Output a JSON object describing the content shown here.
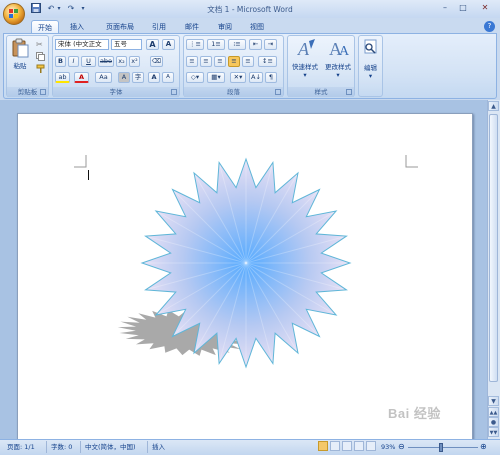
{
  "window": {
    "title": "文档 1 - Microsoft Word",
    "controls": {
      "minimize": "–",
      "maximize": "□",
      "close": "✕"
    }
  },
  "qat": {
    "save_icon": "save-icon",
    "undo": "↶",
    "redo": "↷",
    "dropdown": "▾"
  },
  "tabs": [
    {
      "label": "开始",
      "active": true
    },
    {
      "label": "插入"
    },
    {
      "label": "页面布局"
    },
    {
      "label": "引用"
    },
    {
      "label": "邮件"
    },
    {
      "label": "审阅"
    },
    {
      "label": "视图"
    }
  ],
  "ribbon": {
    "clipboard": {
      "paste_label": "粘贴",
      "group_label": "剪贴板"
    },
    "font": {
      "font_name": "宋体 (中文正文",
      "font_size": "五号",
      "grow": "A",
      "shrink": "A",
      "bold": "B",
      "italic": "I",
      "underline": "U",
      "strike": "abe",
      "subscript": "x₂",
      "superscript": "x²",
      "case": "Aa",
      "highlight": "ab",
      "font_color": "A",
      "char_border": "A",
      "enclosed": "字",
      "wen": "wén",
      "group_label": "字体"
    },
    "paragraph": {
      "group_label": "段落",
      "sort": "A↓",
      "marks": "¶"
    },
    "styles": {
      "quick_styles": "快速样式",
      "change_styles": "更改样式",
      "group_label": "样式"
    },
    "editing": {
      "label": "编辑"
    }
  },
  "statusbar": {
    "page": "页面: 1/1",
    "words": "字数: 0",
    "language": "中文(简体，中国)",
    "mode": "插入",
    "zoom": "93%",
    "zoom_out": "⊖",
    "zoom_in": "⊕"
  },
  "watermark": "Bai 经验",
  "colors": {
    "ribbon": "#dbe7f6",
    "accent": "#15428b",
    "star_center": "#55aaff",
    "star_edge": "#f3e6f5",
    "star_outline": "#5fb6d8",
    "shadow": "#9a9a9a"
  }
}
